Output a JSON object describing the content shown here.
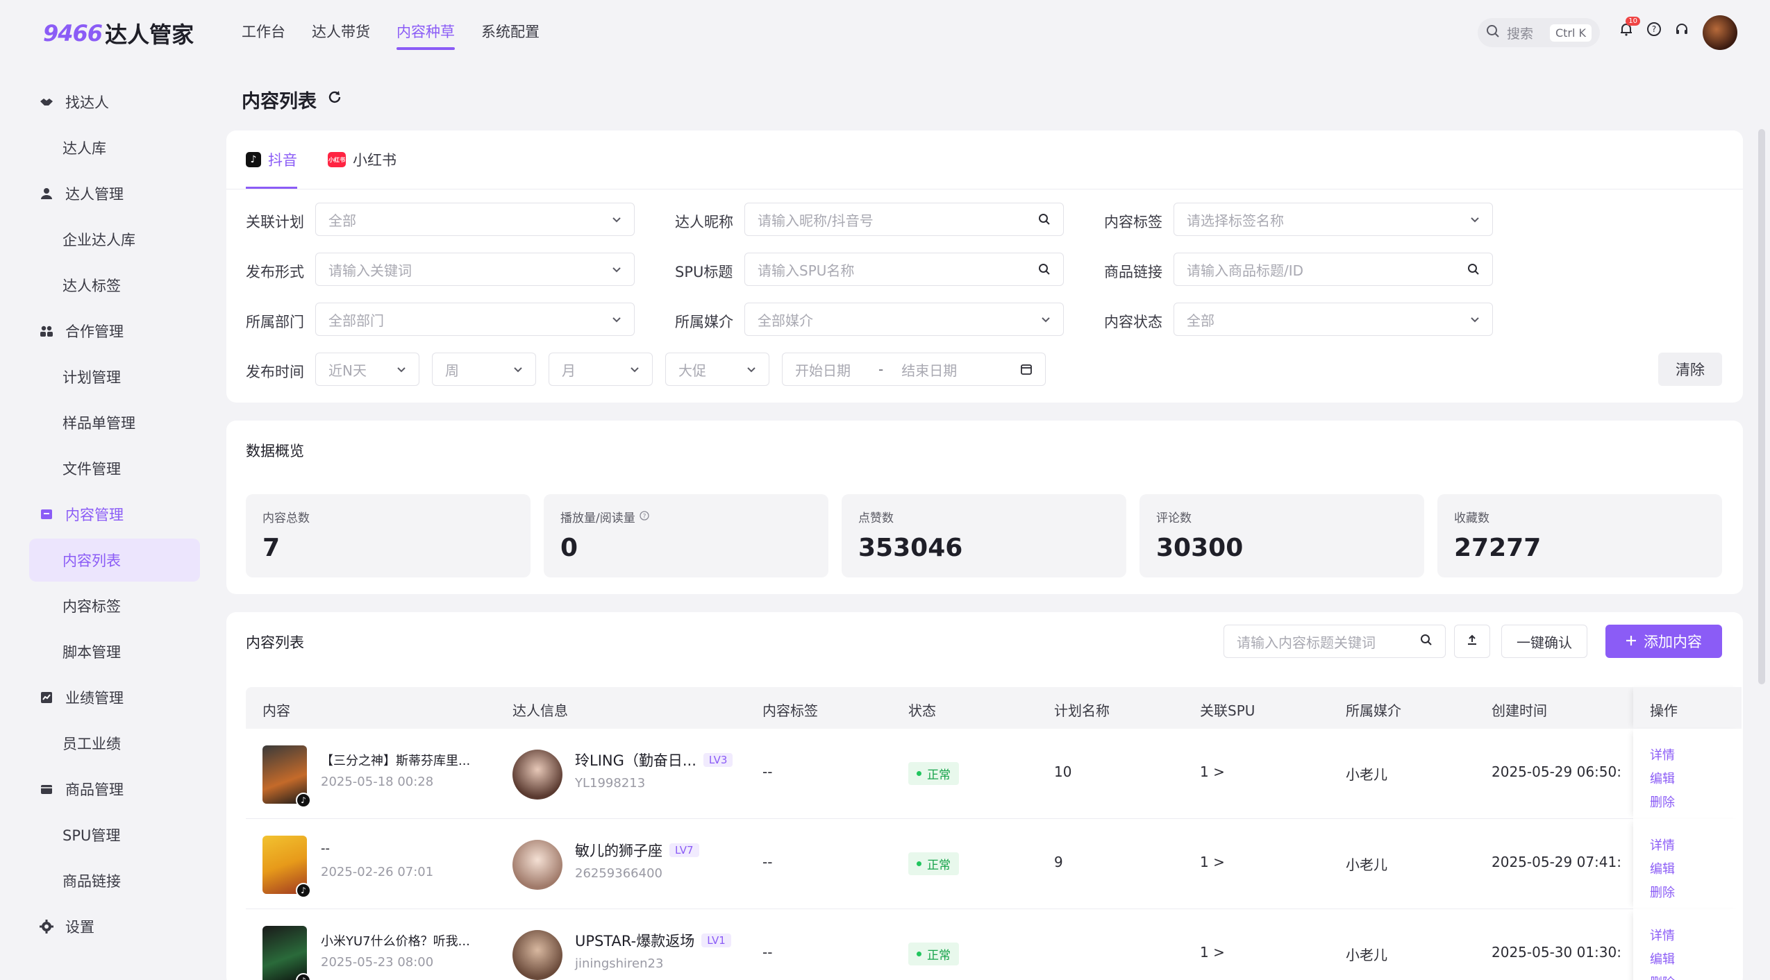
{
  "brand": {
    "num": "9466",
    "name": "达人管家",
    "accent": "#8b5cf6"
  },
  "topnav": [
    {
      "label": "工作台"
    },
    {
      "label": "达人带货"
    },
    {
      "label": "内容种草",
      "active": true
    },
    {
      "label": "系统配置"
    }
  ],
  "search": {
    "placeholder": "搜索",
    "shortcut": "Ctrl K"
  },
  "notifications": {
    "count": "10"
  },
  "sidebar": {
    "items": [
      {
        "label": "找达人",
        "type": "group",
        "icon": "handshake-icon"
      },
      {
        "label": "达人库",
        "type": "sub"
      },
      {
        "label": "达人管理",
        "type": "group",
        "icon": "user-icon"
      },
      {
        "label": "企业达人库",
        "type": "sub"
      },
      {
        "label": "达人标签",
        "type": "sub"
      },
      {
        "label": "合作管理",
        "type": "group",
        "icon": "team-icon"
      },
      {
        "label": "计划管理",
        "type": "sub"
      },
      {
        "label": "样品单管理",
        "type": "sub"
      },
      {
        "label": "文件管理",
        "type": "sub"
      },
      {
        "label": "内容管理",
        "type": "group",
        "icon": "inbox-icon",
        "active": true
      },
      {
        "label": "内容列表",
        "type": "sub",
        "active": true
      },
      {
        "label": "内容标签",
        "type": "sub"
      },
      {
        "label": "脚本管理",
        "type": "sub"
      },
      {
        "label": "业绩管理",
        "type": "group",
        "icon": "chart-icon"
      },
      {
        "label": "员工业绩",
        "type": "sub"
      },
      {
        "label": "商品管理",
        "type": "group",
        "icon": "box-icon"
      },
      {
        "label": "SPU管理",
        "type": "sub"
      },
      {
        "label": "商品链接",
        "type": "sub"
      },
      {
        "label": "设置",
        "type": "group",
        "icon": "gear-icon"
      }
    ]
  },
  "page": {
    "title": "内容列表"
  },
  "tabs": [
    {
      "label": "抖音",
      "active": true
    },
    {
      "label": "小红书",
      "icon_text": "小红书"
    }
  ],
  "filters": {
    "plan": {
      "label": "关联计划",
      "value": "全部"
    },
    "nickname": {
      "label": "达人昵称",
      "placeholder": "请输入昵称/抖音号"
    },
    "content_tag": {
      "label": "内容标签",
      "placeholder": "请选择标签名称"
    },
    "publish_form": {
      "label": "发布形式",
      "placeholder": "请输入关键词"
    },
    "spu": {
      "label": "SPU标题",
      "placeholder": "请输入SPU名称"
    },
    "product_link": {
      "label": "商品链接",
      "placeholder": "请输入商品标题/ID"
    },
    "department": {
      "label": "所属部门",
      "value": "全部部门"
    },
    "media": {
      "label": "所属媒介",
      "value": "全部媒介"
    },
    "content_status": {
      "label": "内容状态",
      "value": "全部"
    },
    "publish_time": {
      "label": "发布时间",
      "recent": "近N天",
      "week": "周",
      "month": "月",
      "promo": "大促",
      "start": "开始日期",
      "sep": "-",
      "end": "结束日期"
    },
    "clear_label": "清除"
  },
  "overview": {
    "title": "数据概览",
    "stats": [
      {
        "label": "内容总数",
        "value": "7"
      },
      {
        "label": "播放量/阅读量",
        "value": "0",
        "help": true
      },
      {
        "label": "点赞数",
        "value": "353046"
      },
      {
        "label": "评论数",
        "value": "30300"
      },
      {
        "label": "收藏数",
        "value": "27277"
      }
    ]
  },
  "list": {
    "title": "内容列表",
    "search_placeholder": "请输入内容标题关键词",
    "confirm_label": "一键确认",
    "add_label": "添加内容",
    "columns": [
      "内容",
      "达人信息",
      "内容标签",
      "状态",
      "计划名称",
      "关联SPU",
      "所属媒介",
      "创建时间",
      "操作"
    ],
    "rows": [
      {
        "title": "【三分之神】斯蒂芬库里...",
        "date": "2025-05-18 00:28",
        "kol_name": "玲LING（勤奋日...",
        "lv": "LV3",
        "kol_id": "YL1998213",
        "tag": "--",
        "status": "正常",
        "plan": "10",
        "spu": "1 >",
        "media": "小老儿",
        "created": "2025-05-29 06:50:",
        "ops": [
          "详情",
          "编辑",
          "删除"
        ]
      },
      {
        "title": "--",
        "date": "2025-02-26 07:01",
        "kol_name": "敏儿的狮子座",
        "lv": "LV7",
        "kol_id": "26259366400",
        "tag": "--",
        "status": "正常",
        "plan": "9",
        "spu": "1 >",
        "media": "小老儿",
        "created": "2025-05-29 07:41:",
        "ops": [
          "详情",
          "编辑",
          "删除"
        ]
      },
      {
        "title": "小米YU7什么价格？听我...",
        "date": "2025-05-23 08:00",
        "kol_name": "UPSTAR-爆款返场",
        "lv": "LV1",
        "kol_id": "jiningshiren23",
        "tag": "--",
        "status": "正常",
        "plan": "",
        "spu": "1 >",
        "media": "小老儿",
        "created": "2025-05-30 01:30:",
        "ops": [
          "详情",
          "编辑",
          "删除"
        ]
      }
    ]
  }
}
